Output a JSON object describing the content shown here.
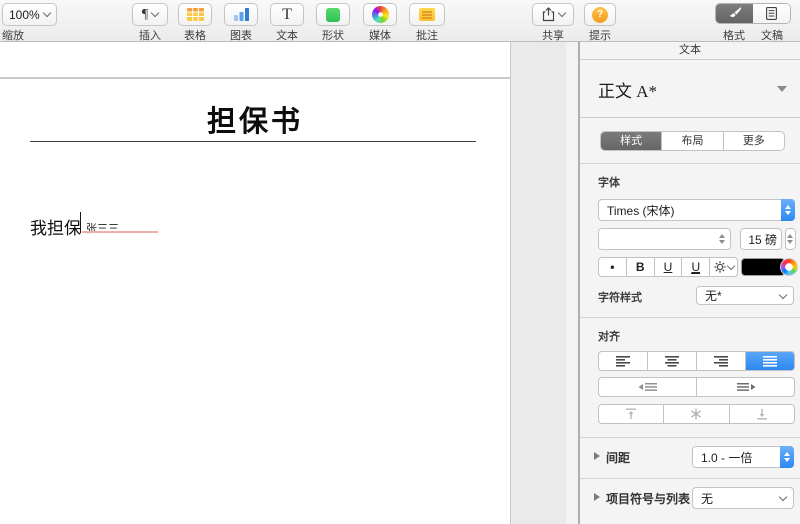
{
  "toolbar": {
    "zoom": {
      "value": "100%",
      "label": "缩放"
    },
    "insert": {
      "label": "插入",
      "icon_glyph": "¶"
    },
    "table": {
      "label": "表格"
    },
    "chart": {
      "label": "图表"
    },
    "text": {
      "label": "文本",
      "icon_glyph": "T"
    },
    "shape": {
      "label": "形状"
    },
    "media": {
      "label": "媒体"
    },
    "comment": {
      "label": "批注"
    },
    "share": {
      "label": "共享"
    },
    "tips": {
      "label": "提示",
      "icon_glyph": "?"
    },
    "format": {
      "label": "格式"
    },
    "document": {
      "label": "文稿"
    }
  },
  "document": {
    "title": "担保书",
    "paragraph": "我担保",
    "filled_text": "张三三"
  },
  "sidebar": {
    "header": "文本",
    "paragraph_style": "正文 A*",
    "tabs": {
      "style": "样式",
      "layout": "布局",
      "more": "更多"
    },
    "font": {
      "section_label": "字体",
      "family": "Times (宋体)",
      "size": "15 磅"
    },
    "format_buttons": {
      "dot": "•",
      "bold": "B",
      "underline": "U",
      "double_underline": "U"
    },
    "char_style": {
      "label": "字符样式",
      "value": "无*"
    },
    "alignment_label": "对齐",
    "spacing": {
      "label": "间距",
      "value": "1.0 - 一倍"
    },
    "bullets": {
      "label": "项目符号与列表",
      "value": "无"
    },
    "colors": {
      "accent_blue": "#2b88f4",
      "font_color_well": "#000000",
      "proof_underline": "#f0b1ae"
    }
  }
}
